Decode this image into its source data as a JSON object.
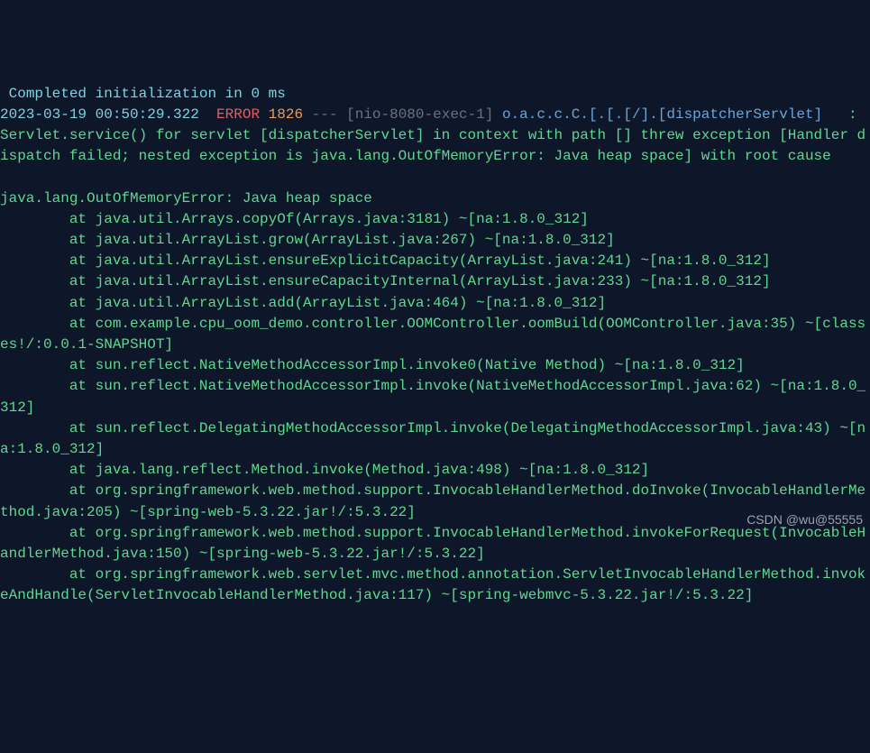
{
  "log": {
    "init_line": " Completed initialization in 0 ms",
    "timestamp": "2023-03-19 00:50:29.322",
    "level": "ERROR",
    "pid": "1826",
    "separator": " --- ",
    "thread": "[nio-8080-exec-1]",
    "logger": "o.a.c.c.C.[.[.[/].[dispatcherServlet]",
    "colon": "   :",
    "message": " Servlet.service() for servlet [dispatcherServlet] in context with path [] threw exception [Handler dispatch failed; nested exception is java.lang.OutOfMemoryError: Java heap space] with root cause",
    "blank": "",
    "exception": "java.lang.OutOfMemoryError: Java heap space",
    "stack": [
      "        at java.util.Arrays.copyOf(Arrays.java:3181) ~[na:1.8.0_312]",
      "        at java.util.ArrayList.grow(ArrayList.java:267) ~[na:1.8.0_312]",
      "        at java.util.ArrayList.ensureExplicitCapacity(ArrayList.java:241) ~[na:1.8.0_312]",
      "        at java.util.ArrayList.ensureCapacityInternal(ArrayList.java:233) ~[na:1.8.0_312]",
      "        at java.util.ArrayList.add(ArrayList.java:464) ~[na:1.8.0_312]",
      "        at com.example.cpu_oom_demo.controller.OOMController.oomBuild(OOMController.java:35) ~[classes!/:0.0.1-SNAPSHOT]",
      "        at sun.reflect.NativeMethodAccessorImpl.invoke0(Native Method) ~[na:1.8.0_312]",
      "        at sun.reflect.NativeMethodAccessorImpl.invoke(NativeMethodAccessorImpl.java:62) ~[na:1.8.0_312]",
      "        at sun.reflect.DelegatingMethodAccessorImpl.invoke(DelegatingMethodAccessorImpl.java:43) ~[na:1.8.0_312]",
      "        at java.lang.reflect.Method.invoke(Method.java:498) ~[na:1.8.0_312]",
      "        at org.springframework.web.method.support.InvocableHandlerMethod.doInvoke(InvocableHandlerMethod.java:205) ~[spring-web-5.3.22.jar!/:5.3.22]",
      "        at org.springframework.web.method.support.InvocableHandlerMethod.invokeForRequest(InvocableHandlerMethod.java:150) ~[spring-web-5.3.22.jar!/:5.3.22]",
      "        at org.springframework.web.servlet.mvc.method.annotation.ServletInvocableHandlerMethod.invokeAndHandle(ServletInvocableHandlerMethod.java:117) ~[spring-webmvc-5.3.22.jar!/:5.3.22]"
    ]
  },
  "watermark": "CSDN @wu@55555"
}
